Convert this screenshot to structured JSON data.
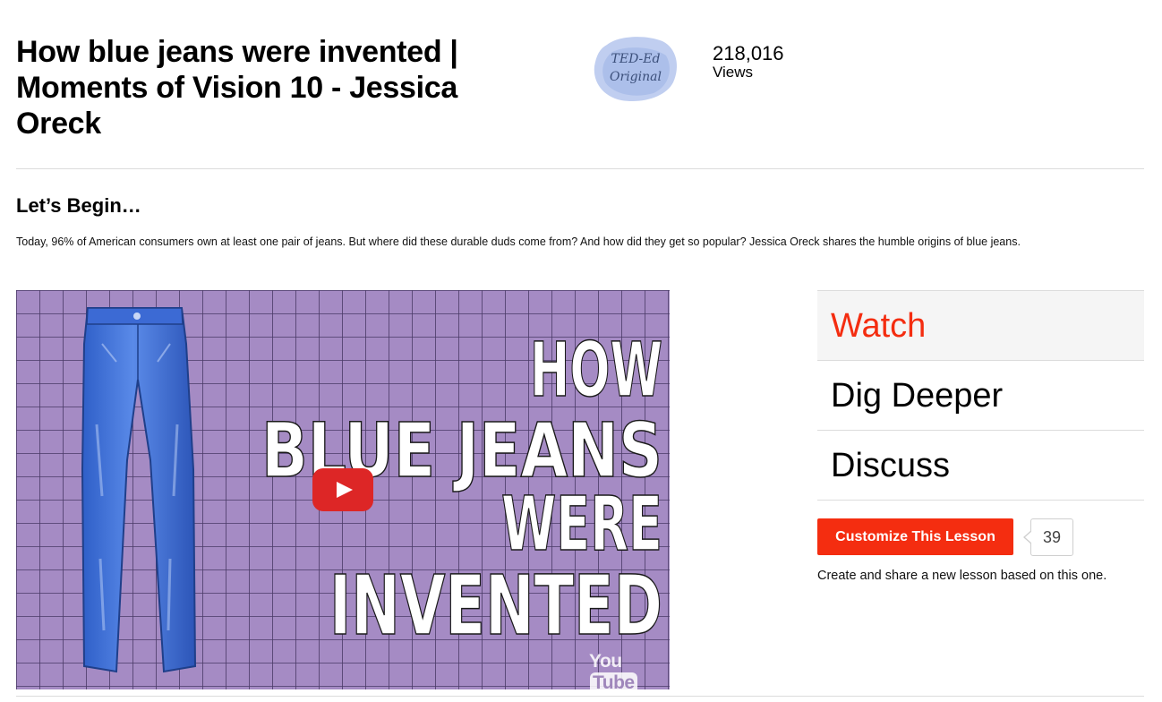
{
  "lesson": {
    "title": "How blue jeans were invented | Moments of Vision 10 - Jessica Oreck",
    "badge_text": [
      "TED-Ed",
      "Original"
    ],
    "views_count": "218,016",
    "views_label": "Views"
  },
  "intro": {
    "heading": "Let’s Begin…",
    "description": "Today, 96% of American consumers own at least one pair of jeans. But where did these durable duds come from? And how did they get so popular? Jessica Oreck shares the humble origins of blue jeans."
  },
  "video": {
    "thumbnail_lines": [
      "HOW",
      "BLUE JEANS",
      "WERE",
      "INVENTED"
    ],
    "watermark_you": "You",
    "watermark_tube": "Tube",
    "play_icon": "youtube-play-icon"
  },
  "tabs": [
    {
      "label": "Watch",
      "active": true
    },
    {
      "label": "Dig Deeper",
      "active": false
    },
    {
      "label": "Discuss",
      "active": false
    }
  ],
  "customize": {
    "button_label": "Customize This Lesson",
    "count": "39",
    "help_text": "Create and share a new lesson based on this one."
  },
  "colors": {
    "accent": "#f42d10",
    "youtube_red": "#dd2626",
    "thumbnail_bg": "#a98fc7",
    "denim": "#3f6fd6"
  }
}
